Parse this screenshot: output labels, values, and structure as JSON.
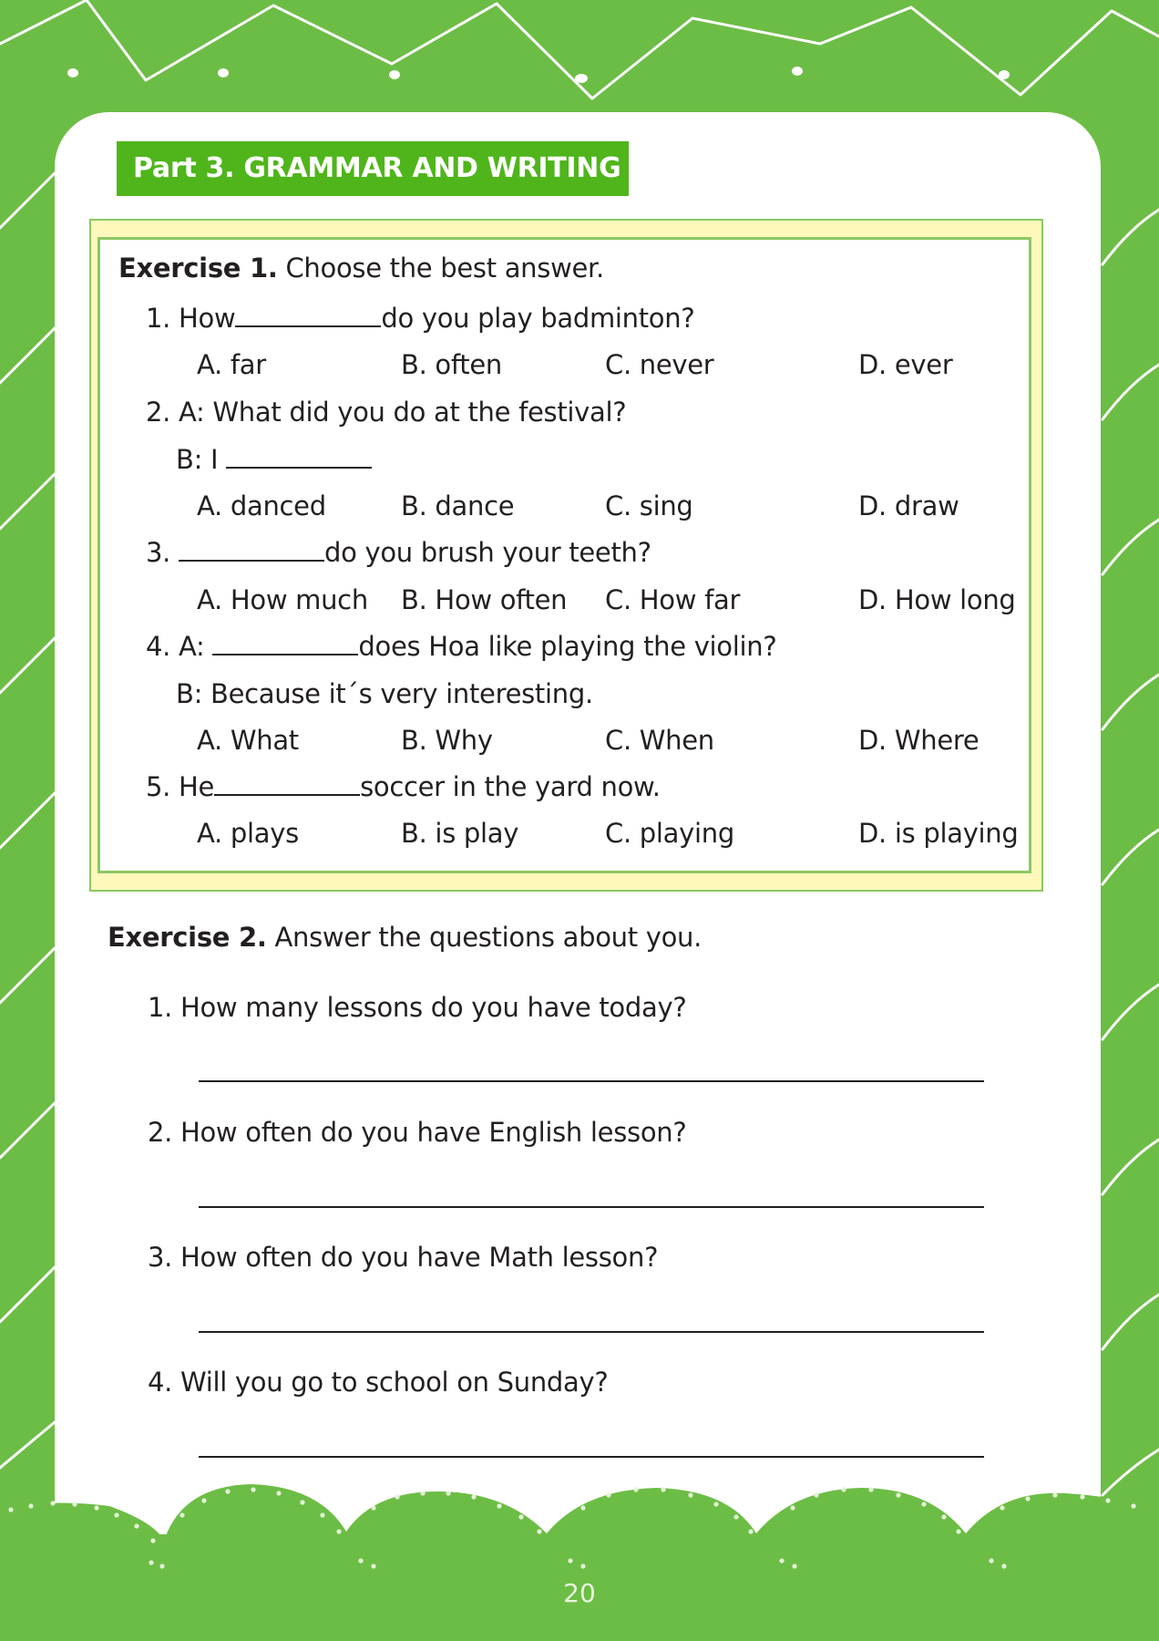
{
  "part_header": "Part 3. GRAMMAR AND WRITING",
  "exercise1": {
    "title": "Exercise 1.",
    "instruction": "Choose the best answer.",
    "q1": {
      "number": "1.",
      "before": "How",
      "after": "do you play badminton?",
      "options": [
        "A. far",
        "B. often",
        "C. never",
        "D. ever"
      ]
    },
    "q2": {
      "number": "2.",
      "line_a": "A: What did you do at the festival?",
      "line_b": "B: I",
      "options": [
        "A. danced",
        "B. dance",
        "C. sing",
        "D. draw"
      ]
    },
    "q3": {
      "number": "3.",
      "after": "do you brush your teeth?",
      "options": [
        "A. How much",
        "B. How often",
        "C. How far",
        "D. How long"
      ]
    },
    "q4": {
      "number": "4.",
      "before": "A:",
      "after": "does Hoa like playing the violin?",
      "line_b": "B: Because it´s very interesting.",
      "options": [
        "A. What",
        "B. Why",
        "C. When",
        "D. Where"
      ]
    },
    "q5": {
      "number": "5.",
      "before": "He",
      "after": "soccer in the yard now.",
      "options": [
        "A. plays",
        "B. is play",
        "C. playing",
        "D. is playing"
      ]
    }
  },
  "exercise2": {
    "title": "Exercise 2.",
    "instruction": "Answer the questions about you.",
    "questions": [
      "1. How many lessons do you have today?",
      "2. How often do you have English lesson?",
      "3. How often do you have Math lesson?",
      "4. Will you go to school on Sunday?"
    ]
  },
  "page_number": "20",
  "colors": {
    "background": "#6cbd45",
    "header": "#4fb51b",
    "box_fill": "#fff8bd",
    "box_border": "#8dc862"
  }
}
